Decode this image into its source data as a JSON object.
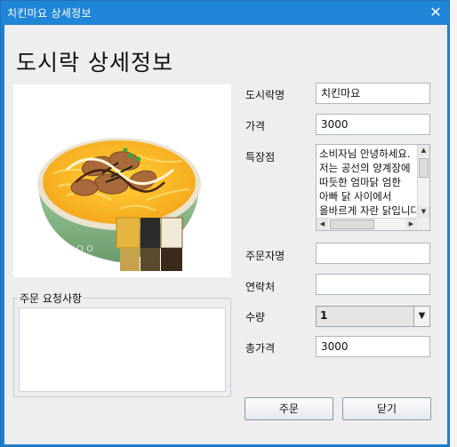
{
  "window": {
    "title": "치킨마요 상세정보",
    "close_glyph": "✕"
  },
  "heading": "도시락 상세정보",
  "fields": {
    "name_label": "도시락명",
    "name_value": "치킨마요",
    "price_label": "가격",
    "price_value": "3000",
    "features_label": "특장점",
    "features_lines": [
      "소비자님 안녕하세요.",
      "저는 공선의 양계장에",
      "따듯한 엄마닭 엄한",
      "아빠 닭 사이에서",
      "올바르게 자란 닭입니다"
    ],
    "orderer_label": "주문자명",
    "orderer_value": "",
    "contact_label": "연락처",
    "contact_value": "",
    "qty_label": "수량",
    "qty_value": "1",
    "total_label": "총가격",
    "total_value": "3000"
  },
  "request": {
    "label": "주문 요청사항",
    "value": ""
  },
  "buttons": {
    "order": "주문",
    "close": "닫기"
  },
  "icons": {
    "close": "close-icon",
    "combo_arrow": "chevron-down-icon"
  },
  "colors": {
    "titlebar": "#1f86d8",
    "panel": "#eeeeee"
  }
}
